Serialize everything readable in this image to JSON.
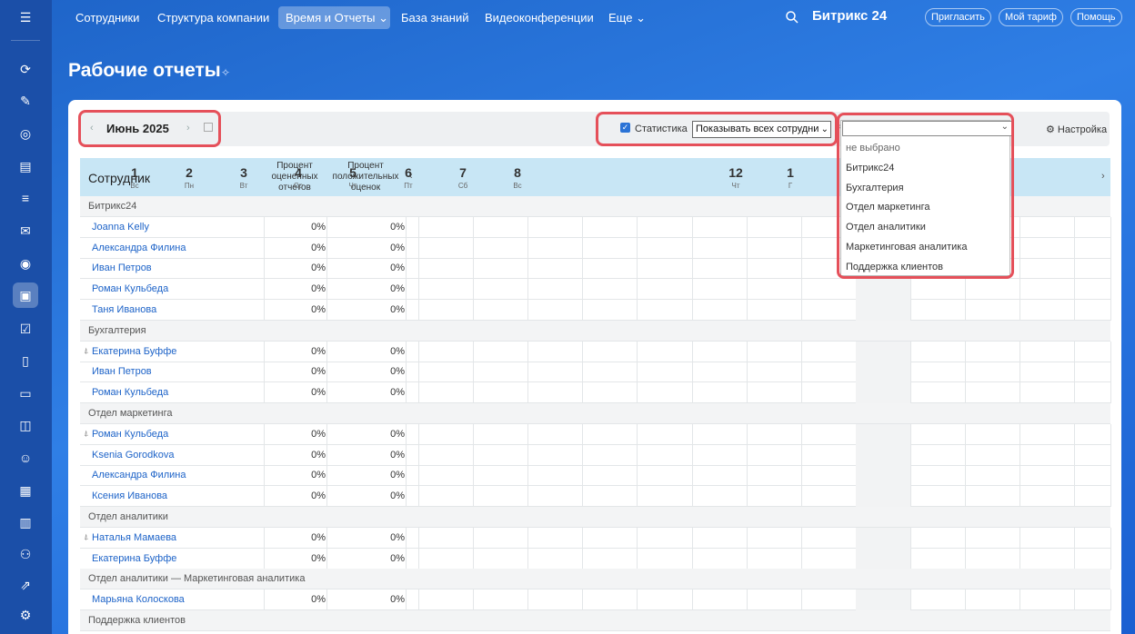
{
  "nav": {
    "items": [
      {
        "label": "Сотрудники"
      },
      {
        "label": "Структура компании"
      },
      {
        "label": "Время и Отчеты ⌄"
      },
      {
        "label": "База знаний"
      },
      {
        "label": "Видеоконференции"
      },
      {
        "label": "Еще ⌄"
      }
    ],
    "brand": "Битрикс 24",
    "invite": "Пригласить",
    "tariff": "Мой тариф",
    "help": "Помощь"
  },
  "page": {
    "title": "Рабочие отчеты"
  },
  "toolbar": {
    "month": "Июнь 2025",
    "stats_label": "Статистика",
    "filter_value": "Показывать всех сотрудни",
    "settings_label": "Настройка"
  },
  "table": {
    "header": {
      "employee": "Сотрудник",
      "pct_rated": "Процент оцененных отчетов",
      "pct_positive": "Процент положительных оценок"
    },
    "days": [
      {
        "num": "1",
        "wd": "Вс"
      },
      {
        "num": "2",
        "wd": "Пн"
      },
      {
        "num": "3",
        "wd": "Вт"
      },
      {
        "num": "4",
        "wd": "Ср"
      },
      {
        "num": "5",
        "wd": "Чт"
      },
      {
        "num": "6",
        "wd": "Пт"
      },
      {
        "num": "7",
        "wd": "Сб"
      },
      {
        "num": "8",
        "wd": "Вс"
      },
      {
        "num": "12",
        "wd": "Чт"
      },
      {
        "num": "1",
        "wd": "Г"
      }
    ],
    "rows": [
      {
        "type": "group",
        "label": "Битрикс24"
      },
      {
        "type": "emp",
        "name": "Joanna Kelly",
        "p1": "0%",
        "p2": "0%"
      },
      {
        "type": "emp",
        "name": "Александра Филина",
        "p1": "0%",
        "p2": "0%"
      },
      {
        "type": "emp",
        "name": "Иван Петров",
        "p1": "0%",
        "p2": "0%"
      },
      {
        "type": "emp",
        "name": "Роман Кульбеда",
        "p1": "0%",
        "p2": "0%"
      },
      {
        "type": "emp",
        "name": "Таня Иванова",
        "p1": "0%",
        "p2": "0%"
      },
      {
        "type": "group",
        "label": "Бухгалтерия"
      },
      {
        "type": "emp",
        "name": "Екатерина Буффе",
        "p1": "0%",
        "p2": "0%",
        "head": true
      },
      {
        "type": "emp",
        "name": "Иван Петров",
        "p1": "0%",
        "p2": "0%"
      },
      {
        "type": "emp",
        "name": "Роман Кульбеда",
        "p1": "0%",
        "p2": "0%"
      },
      {
        "type": "group",
        "label": "Отдел маркетинга"
      },
      {
        "type": "emp",
        "name": "Роман Кульбеда",
        "p1": "0%",
        "p2": "0%",
        "head": true
      },
      {
        "type": "emp",
        "name": "Ksenia Gorodkova",
        "p1": "0%",
        "p2": "0%"
      },
      {
        "type": "emp",
        "name": "Александра Филина",
        "p1": "0%",
        "p2": "0%"
      },
      {
        "type": "emp",
        "name": "Ксения Иванова",
        "p1": "0%",
        "p2": "0%"
      },
      {
        "type": "group",
        "label": "Отдел аналитики"
      },
      {
        "type": "emp",
        "name": "Наталья Мамаева",
        "p1": "0%",
        "p2": "0%",
        "head": true
      },
      {
        "type": "emp",
        "name": "Екатерина Буффе",
        "p1": "0%",
        "p2": "0%"
      },
      {
        "type": "group",
        "label": "Отдел аналитики  —  Маркетинговая аналитика"
      },
      {
        "type": "emp",
        "name": "Марьяна Колоскова",
        "p1": "0%",
        "p2": "0%"
      },
      {
        "type": "group",
        "label": "Поддержка клиентов"
      }
    ]
  },
  "dept_dropdown": {
    "options": [
      "не выбрано",
      "Битрикс24",
      "Бухгалтерия",
      "Отдел маркетинга",
      "Отдел аналитики",
      "Маркетинговая аналитика",
      "Поддержка клиентов"
    ]
  }
}
